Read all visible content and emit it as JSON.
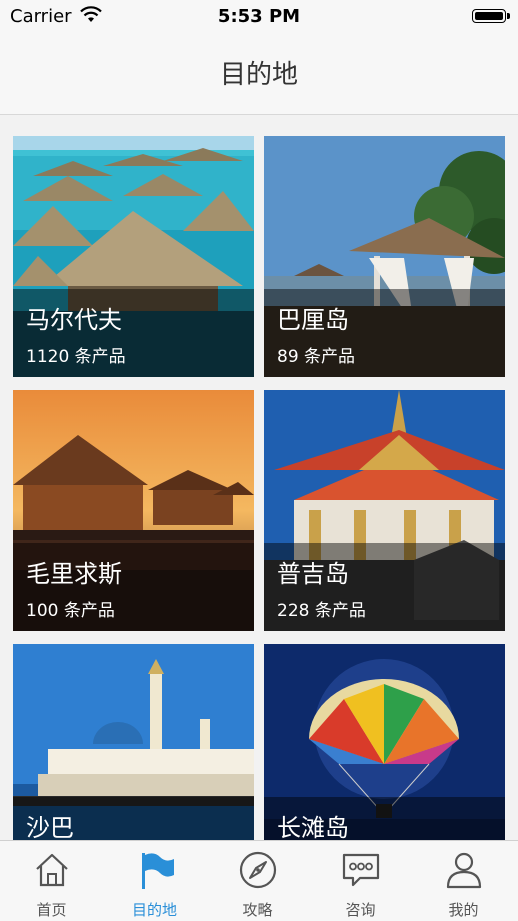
{
  "status_bar": {
    "carrier": "Carrier",
    "time": "5:53 PM"
  },
  "nav": {
    "title": "目的地"
  },
  "destinations": [
    {
      "name": "马尔代夫",
      "count": "1120 条产品"
    },
    {
      "name": "巴厘岛",
      "count": "89 条产品"
    },
    {
      "name": "毛里求斯",
      "count": "100 条产品"
    },
    {
      "name": "普吉岛",
      "count": "228 条产品"
    },
    {
      "name": "沙巴",
      "count": ""
    },
    {
      "name": "长滩岛",
      "count": ""
    }
  ],
  "tabs": [
    {
      "label": "首页",
      "icon": "home-icon"
    },
    {
      "label": "目的地",
      "icon": "flag-icon"
    },
    {
      "label": "攻略",
      "icon": "compass-icon"
    },
    {
      "label": "咨询",
      "icon": "chat-icon"
    },
    {
      "label": "我的",
      "icon": "user-icon"
    }
  ],
  "colors": {
    "accent": "#2a8fd8",
    "nav_bg": "#f7f7f7",
    "tab_inactive": "#555555"
  }
}
